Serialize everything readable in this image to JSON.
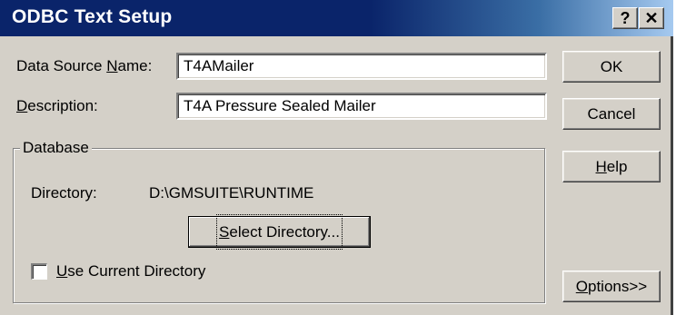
{
  "window": {
    "title": "ODBC Text Setup",
    "help_button": "?",
    "close_button": "✕"
  },
  "form": {
    "data_source_name": {
      "label_pre": "Data Source ",
      "label_accel": "N",
      "label_post": "ame:",
      "value": "T4AMailer"
    },
    "description": {
      "label_pre": "",
      "label_accel": "D",
      "label_post": "escription:",
      "value": "T4A Pressure Sealed Mailer"
    }
  },
  "database": {
    "legend": "Database",
    "directory_label": "Directory:",
    "directory_value": "D:\\GMSUITE\\RUNTIME",
    "select_directory": {
      "pre": "",
      "accel": "S",
      "post": "elect Directory..."
    },
    "use_current_directory": {
      "pre": "",
      "accel": "U",
      "post": "se Current Directory",
      "checked": false
    }
  },
  "buttons": {
    "ok": "OK",
    "cancel": "Cancel",
    "help": {
      "pre": "",
      "accel": "H",
      "post": "elp"
    },
    "options": {
      "pre": "",
      "accel": "O",
      "post": "ptions>>"
    }
  }
}
